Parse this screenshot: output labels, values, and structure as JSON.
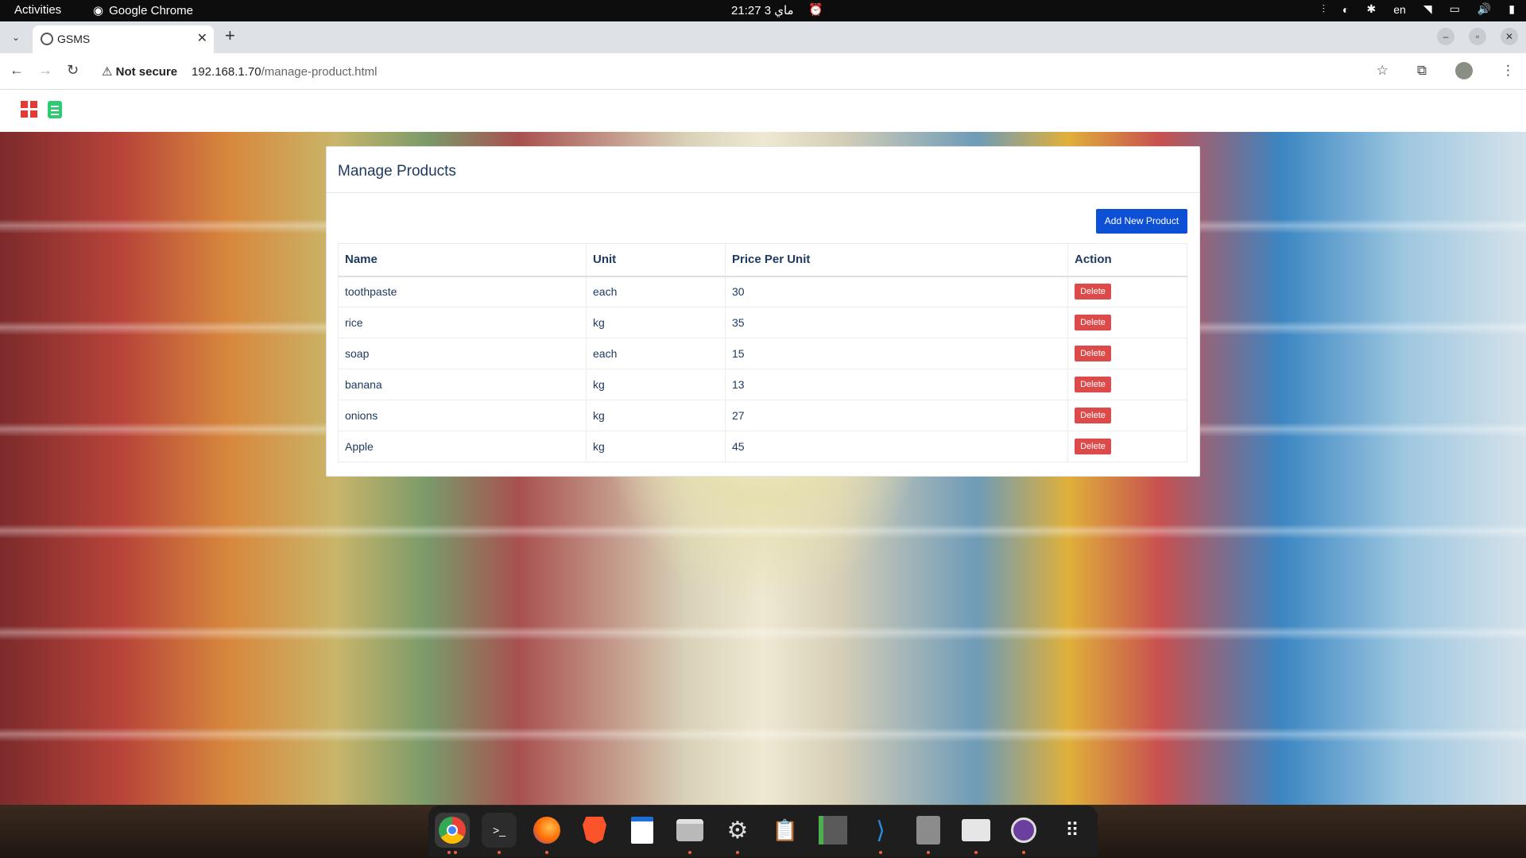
{
  "topbar": {
    "activities": "Activities",
    "app_name": "Google Chrome",
    "clock": "21:27  3 ماي",
    "lang": "en"
  },
  "browser": {
    "tab_title": "GSMS",
    "security_label": "Not secure",
    "url_host": "192.168.1.70",
    "url_path": "/manage-product.html"
  },
  "page": {
    "card_title": "Manage Products",
    "add_button": "Add New Product",
    "columns": [
      "Name",
      "Unit",
      "Price Per Unit",
      "Action"
    ],
    "rows": [
      {
        "name": "toothpaste",
        "unit": "each",
        "price": "30",
        "action": "Delete"
      },
      {
        "name": "rice",
        "unit": "kg",
        "price": "35",
        "action": "Delete"
      },
      {
        "name": "soap",
        "unit": "each",
        "price": "15",
        "action": "Delete"
      },
      {
        "name": "banana",
        "unit": "kg",
        "price": "13",
        "action": "Delete"
      },
      {
        "name": "onions",
        "unit": "kg",
        "price": "27",
        "action": "Delete"
      },
      {
        "name": "Apple",
        "unit": "kg",
        "price": "45",
        "action": "Delete"
      }
    ]
  },
  "dock": {
    "apps": [
      "chrome-icon",
      "terminal-icon",
      "firefox-icon",
      "brave-icon",
      "writer-icon",
      "files-icon",
      "settings-icon",
      "clipboard-icon",
      "sublime-icon",
      "vscode-icon",
      "ssd-icon",
      "screenshot-icon",
      "media-player-icon",
      "app-grid-icon"
    ]
  },
  "colors": {
    "primary_button": "#0d50d6",
    "delete_button": "#dc4a4a",
    "heading_text": "#1f3a60"
  }
}
